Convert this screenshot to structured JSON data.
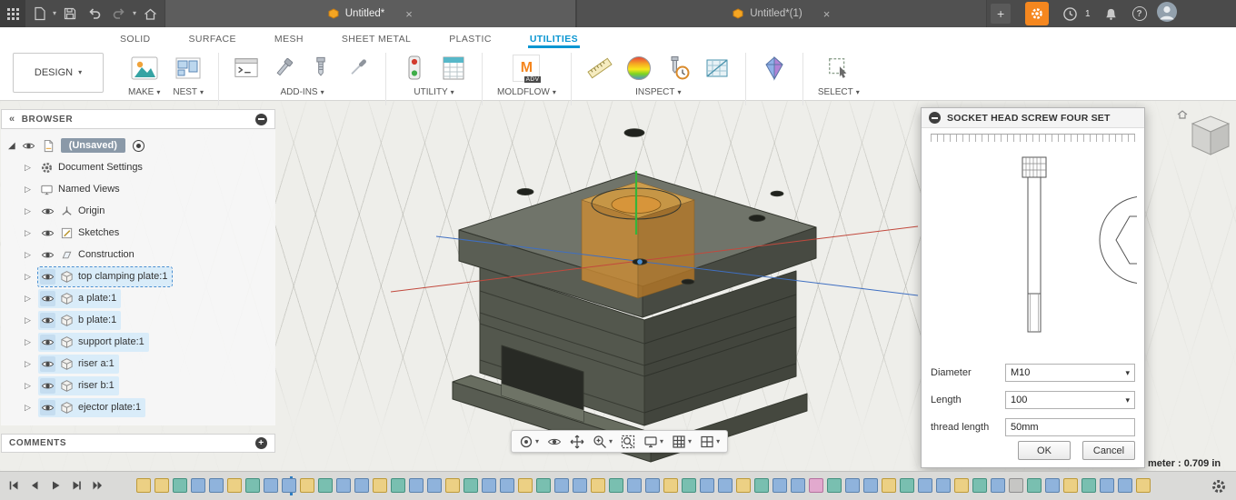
{
  "titlebar": {
    "tabs": [
      {
        "label": "Untitled*",
        "active": true
      },
      {
        "label": "Untitled*(1)",
        "active": false
      }
    ],
    "job_count": "1"
  },
  "ribbon": {
    "tabs": [
      {
        "label": "SOLID"
      },
      {
        "label": "SURFACE"
      },
      {
        "label": "MESH"
      },
      {
        "label": "SHEET METAL"
      },
      {
        "label": "PLASTIC"
      },
      {
        "label": "UTILITIES",
        "active": true
      }
    ],
    "design_label": "DESIGN",
    "groups": {
      "make": "MAKE",
      "nest": "NEST",
      "addins": "ADD-INS",
      "utility": "UTILITY",
      "moldflow": "MOLDFLOW",
      "inspect": "INSPECT",
      "select": "SELECT"
    },
    "moldflow_letter": "M",
    "moldflow_badge": "ADV"
  },
  "browser": {
    "header": "BROWSER",
    "root_label": "(Unsaved)",
    "items": [
      {
        "label": "Document Settings",
        "icon": "gear",
        "eye": false
      },
      {
        "label": "Named Views",
        "icon": "views",
        "eye": false
      },
      {
        "label": "Origin",
        "icon": "axes",
        "eye": true
      },
      {
        "label": "Sketches",
        "icon": "sketch",
        "eye": true
      },
      {
        "label": "Construction",
        "icon": "construction",
        "eye": true
      },
      {
        "label": "top clamping plate:1",
        "icon": "component",
        "eye": true,
        "comp": true,
        "dashed": true
      },
      {
        "label": "a plate:1",
        "icon": "component",
        "eye": true,
        "comp": true
      },
      {
        "label": "b plate:1",
        "icon": "component",
        "eye": true,
        "comp": true
      },
      {
        "label": "support plate:1",
        "icon": "component",
        "eye": true,
        "comp": true
      },
      {
        "label": "riser a:1",
        "icon": "component",
        "eye": true,
        "comp": true
      },
      {
        "label": "riser b:1",
        "icon": "component",
        "eye": true,
        "comp": true
      },
      {
        "label": "ejector plate:1",
        "icon": "component",
        "eye": true,
        "comp": true
      }
    ],
    "comments_header": "COMMENTS"
  },
  "dialog": {
    "title": "SOCKET HEAD SCREW FOUR SET",
    "fields": [
      {
        "label": "Diameter",
        "value": "M10",
        "control": "select"
      },
      {
        "label": "Length",
        "value": "100",
        "control": "select"
      },
      {
        "label": "thread length",
        "value": "50mm",
        "control": "input"
      }
    ],
    "ok_label": "OK",
    "cancel_label": "Cancel"
  },
  "status": {
    "measure_text": "meter : 0.709 in"
  },
  "timeline": {
    "icons": [
      "y",
      "y",
      "t",
      "b",
      "b",
      "y",
      "t",
      "b",
      "b",
      "y",
      "t",
      "b",
      "b",
      "y",
      "t",
      "b",
      "b",
      "y",
      "t",
      "b",
      "b",
      "y",
      "t",
      "b",
      "b",
      "y",
      "t",
      "b",
      "b",
      "y",
      "t",
      "b",
      "b",
      "y",
      "t",
      "b",
      "b",
      "p",
      "t",
      "b",
      "b",
      "y",
      "t",
      "b",
      "b",
      "y",
      "t",
      "b",
      "g",
      "t",
      "b",
      "y",
      "t",
      "b",
      "b",
      "y"
    ]
  }
}
